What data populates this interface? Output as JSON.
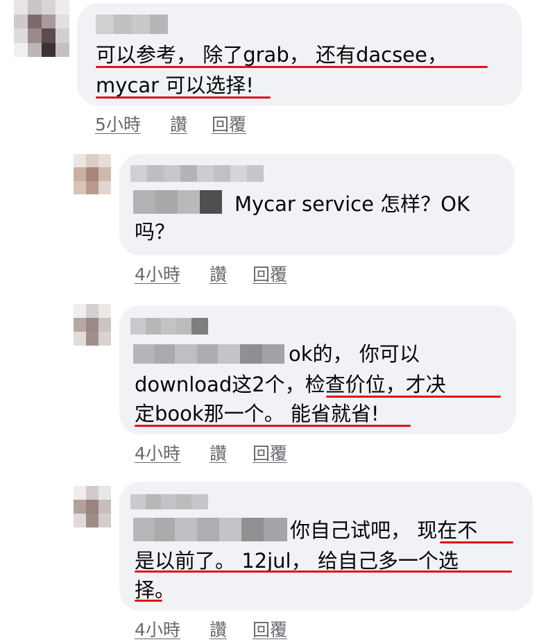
{
  "comments": [
    {
      "lines": [
        "可以参考， 除了grab， 还有dacsee，",
        "mycar 可以选择!"
      ],
      "time": "5小時",
      "like": "讚",
      "reply": "回覆"
    },
    {
      "lines": [
        "Mycar service 怎样？OK",
        "吗？"
      ],
      "time": "4小時",
      "like": "讚",
      "reply": "回覆"
    },
    {
      "lines": [
        "ok的， 你可以",
        "download这2个，检查价位，才决",
        "定book那一个。 能省就省!"
      ],
      "time": "4小時",
      "like": "讚",
      "reply": "回覆"
    },
    {
      "lines": [
        "你自己试吧， 现在不",
        "是以前了。 12jul， 给自己多一个选",
        "择。"
      ],
      "time": "4小時",
      "like": "讚",
      "reply": "回覆"
    }
  ],
  "colors": {
    "bubble": "#f0f2f5",
    "underline": "#e0101a",
    "meta": "#65676b"
  }
}
